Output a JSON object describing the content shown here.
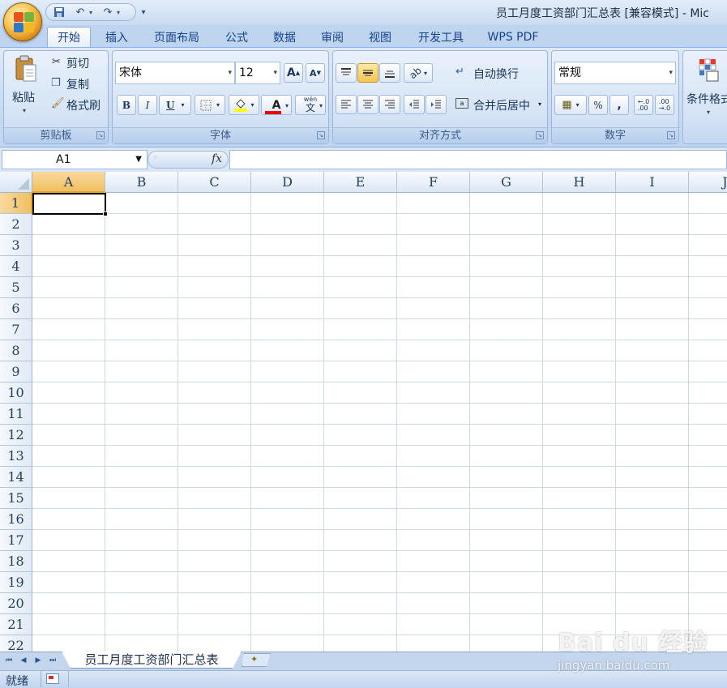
{
  "window": {
    "title": "员工月度工资部门汇总表  [兼容模式] - Mic"
  },
  "tabs": [
    {
      "label": "开始"
    },
    {
      "label": "插入"
    },
    {
      "label": "页面布局"
    },
    {
      "label": "公式"
    },
    {
      "label": "数据"
    },
    {
      "label": "审阅"
    },
    {
      "label": "视图"
    },
    {
      "label": "开发工具"
    },
    {
      "label": "WPS PDF"
    }
  ],
  "clipboard": {
    "paste": "粘贴",
    "cut": "剪切",
    "copy": "复制",
    "format_painter": "格式刷",
    "group": "剪贴板"
  },
  "font": {
    "name": "宋体",
    "size": "12",
    "bold": "B",
    "italic": "I",
    "underline": "U",
    "grow": "A",
    "shrink": "A",
    "color_letter": "A",
    "phonetic": "wén",
    "phonetic_char": "文",
    "group": "字体"
  },
  "align": {
    "wrap": "自动换行",
    "merge": "合并后居中",
    "group": "对齐方式"
  },
  "number": {
    "format": "常规",
    "percent": "%",
    "comma": ",",
    "inc_decimal": "←.0\n.00",
    "group": "数字"
  },
  "styles": {
    "conditional": "条件格式"
  },
  "formula_bar": {
    "name_box": "A1",
    "fx": "fx",
    "value": ""
  },
  "columns": [
    "A",
    "B",
    "C",
    "D",
    "E",
    "F",
    "G",
    "H",
    "I",
    "J"
  ],
  "rows": [
    "1",
    "2",
    "3",
    "4",
    "5",
    "6",
    "7",
    "8",
    "9",
    "10",
    "11",
    "12",
    "13",
    "14",
    "15",
    "16",
    "17",
    "18",
    "19",
    "20",
    "21",
    "22"
  ],
  "active_cell": "A1",
  "sheets": [
    {
      "name": "员工月度工资部门汇总表"
    }
  ],
  "status": {
    "ready": "就绪"
  },
  "watermark": {
    "brand": "Bai du 经验",
    "url": "jingyan.baidu.com"
  },
  "colors": {
    "accent": "#15428b",
    "selected_header": "#f1c15f",
    "ribbon": "#c5d9f1"
  }
}
